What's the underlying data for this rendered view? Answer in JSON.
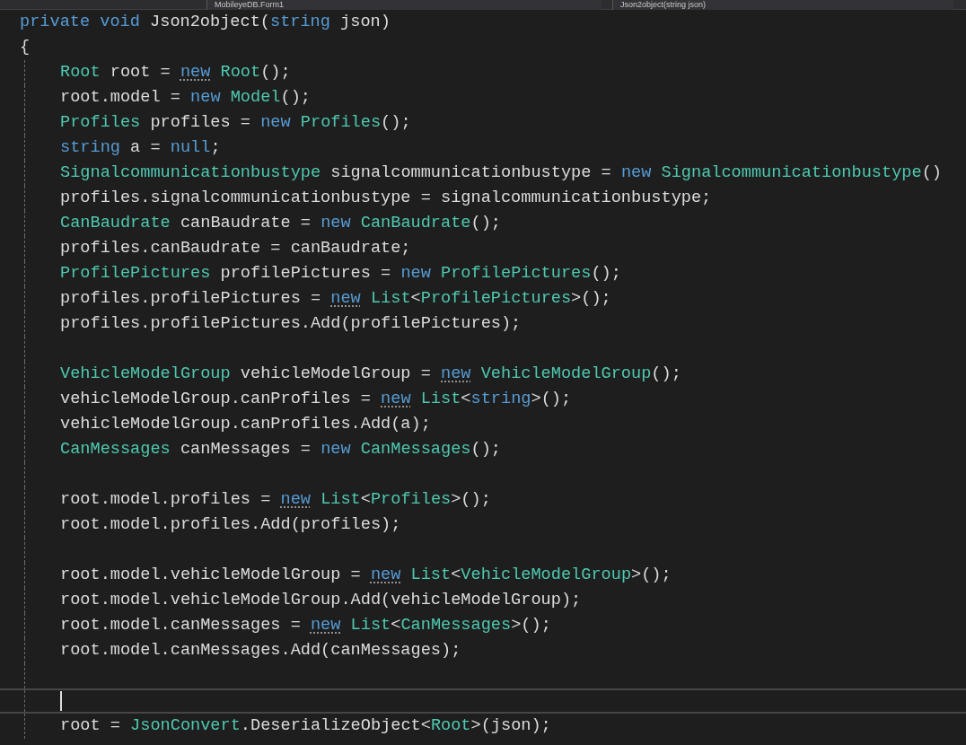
{
  "navigation_bar": {
    "class_dropdown": "MobileyeDB.Form1",
    "member_dropdown": "Json2object(string json)"
  },
  "code_lines": [
    {
      "current": false,
      "tokens": [
        {
          "kind": "keyword",
          "text": "private void "
        },
        {
          "kind": "plain",
          "text": "Json2object("
        },
        {
          "kind": "keyword",
          "text": "string"
        },
        {
          "kind": "plain",
          "text": " json)"
        }
      ]
    },
    {
      "current": false,
      "tokens": [
        {
          "kind": "plain",
          "text": "{"
        }
      ],
      "children": [
        {
          "current": false,
          "tokens": [
            {
              "kind": "type",
              "text": "Root"
            },
            {
              "kind": "plain",
              "text": " root = "
            },
            {
              "kind": "keyword",
              "text": "new",
              "hint": true
            },
            {
              "kind": "type",
              "text": " Root"
            },
            {
              "kind": "plain",
              "text": "();"
            }
          ]
        },
        {
          "current": false,
          "tokens": [
            {
              "kind": "plain",
              "text": "root.model = "
            },
            {
              "kind": "keyword",
              "text": "new"
            },
            {
              "kind": "type",
              "text": " Model"
            },
            {
              "kind": "plain",
              "text": "();"
            }
          ]
        },
        {
          "current": false,
          "tokens": [
            {
              "kind": "type",
              "text": "Profiles"
            },
            {
              "kind": "plain",
              "text": " profiles = "
            },
            {
              "kind": "keyword",
              "text": "new"
            },
            {
              "kind": "type",
              "text": " Profiles"
            },
            {
              "kind": "plain",
              "text": "();"
            }
          ]
        },
        {
          "current": false,
          "tokens": [
            {
              "kind": "keyword",
              "text": "string"
            },
            {
              "kind": "plain",
              "text": " a = "
            },
            {
              "kind": "keyword",
              "text": "null"
            },
            {
              "kind": "plain",
              "text": ";"
            }
          ]
        },
        {
          "current": false,
          "tokens": [
            {
              "kind": "type",
              "text": "Signalcommunicationbustype"
            },
            {
              "kind": "plain",
              "text": " signalcommunicationbustype = "
            },
            {
              "kind": "keyword",
              "text": "new"
            },
            {
              "kind": "type",
              "text": " Signalcommunicationbustype"
            },
            {
              "kind": "plain",
              "text": "()"
            }
          ]
        },
        {
          "current": false,
          "tokens": [
            {
              "kind": "plain",
              "text": "profiles.signalcommunicationbustype = signalcommunicationbustype;"
            }
          ]
        },
        {
          "current": false,
          "tokens": [
            {
              "kind": "type",
              "text": "CanBaudrate"
            },
            {
              "kind": "plain",
              "text": " canBaudrate = "
            },
            {
              "kind": "keyword",
              "text": "new"
            },
            {
              "kind": "type",
              "text": " CanBaudrate"
            },
            {
              "kind": "plain",
              "text": "();"
            }
          ]
        },
        {
          "current": false,
          "tokens": [
            {
              "kind": "plain",
              "text": "profiles.canBaudrate = canBaudrate;"
            }
          ]
        },
        {
          "current": false,
          "tokens": [
            {
              "kind": "type",
              "text": "ProfilePictures"
            },
            {
              "kind": "plain",
              "text": " profilePictures = "
            },
            {
              "kind": "keyword",
              "text": "new"
            },
            {
              "kind": "type",
              "text": " ProfilePictures"
            },
            {
              "kind": "plain",
              "text": "();"
            }
          ]
        },
        {
          "current": false,
          "tokens": [
            {
              "kind": "plain",
              "text": "profiles.profilePictures = "
            },
            {
              "kind": "keyword",
              "text": "new",
              "hint": true
            },
            {
              "kind": "type",
              "text": " List"
            },
            {
              "kind": "plain",
              "text": "<"
            },
            {
              "kind": "type",
              "text": "ProfilePictures"
            },
            {
              "kind": "plain",
              "text": ">();"
            }
          ]
        },
        {
          "current": false,
          "tokens": [
            {
              "kind": "plain",
              "text": "profiles.profilePictures.Add(profilePictures);"
            }
          ]
        },
        {
          "current": false
        },
        {
          "current": false,
          "tokens": [
            {
              "kind": "type",
              "text": "VehicleModelGroup"
            },
            {
              "kind": "plain",
              "text": " vehicleModelGroup = "
            },
            {
              "kind": "keyword",
              "text": "new",
              "hint": true
            },
            {
              "kind": "type",
              "text": " VehicleModelGroup"
            },
            {
              "kind": "plain",
              "text": "();"
            }
          ]
        },
        {
          "current": false,
          "tokens": [
            {
              "kind": "plain",
              "text": "vehicleModelGroup.canProfiles = "
            },
            {
              "kind": "keyword",
              "text": "new",
              "hint": true
            },
            {
              "kind": "type",
              "text": " List"
            },
            {
              "kind": "plain",
              "text": "<"
            },
            {
              "kind": "keyword",
              "text": "string"
            },
            {
              "kind": "plain",
              "text": ">();"
            }
          ]
        },
        {
          "current": false,
          "tokens": [
            {
              "kind": "plain",
              "text": "vehicleModelGroup.canProfiles.Add(a);"
            }
          ]
        },
        {
          "current": false,
          "tokens": [
            {
              "kind": "type",
              "text": "CanMessages"
            },
            {
              "kind": "plain",
              "text": " canMessages = "
            },
            {
              "kind": "keyword",
              "text": "new"
            },
            {
              "kind": "type",
              "text": " CanMessages"
            },
            {
              "kind": "plain",
              "text": "();"
            }
          ]
        },
        {
          "current": false
        },
        {
          "current": false,
          "tokens": [
            {
              "kind": "plain",
              "text": "root.model.profiles = "
            },
            {
              "kind": "keyword",
              "text": "new",
              "hint": true
            },
            {
              "kind": "type",
              "text": " List"
            },
            {
              "kind": "plain",
              "text": "<"
            },
            {
              "kind": "type",
              "text": "Profiles"
            },
            {
              "kind": "plain",
              "text": ">();"
            }
          ]
        },
        {
          "current": false,
          "tokens": [
            {
              "kind": "plain",
              "text": "root.model.profiles.Add(profiles);"
            }
          ]
        },
        {
          "current": false
        },
        {
          "current": false,
          "tokens": [
            {
              "kind": "plain",
              "text": "root.model.vehicleModelGroup = "
            },
            {
              "kind": "keyword",
              "text": "new",
              "hint": true
            },
            {
              "kind": "type",
              "text": " List"
            },
            {
              "kind": "plain",
              "text": "<"
            },
            {
              "kind": "type",
              "text": "VehicleModelGroup"
            },
            {
              "kind": "plain",
              "text": ">();"
            }
          ]
        },
        {
          "current": false,
          "tokens": [
            {
              "kind": "plain",
              "text": "root.model.vehicleModelGroup.Add(vehicleModelGroup);"
            }
          ]
        },
        {
          "current": false,
          "tokens": [
            {
              "kind": "plain",
              "text": "root.model.canMessages = "
            },
            {
              "kind": "keyword",
              "text": "new",
              "hint": true
            },
            {
              "kind": "type",
              "text": " List"
            },
            {
              "kind": "plain",
              "text": "<"
            },
            {
              "kind": "type",
              "text": "CanMessages"
            },
            {
              "kind": "plain",
              "text": ">();"
            }
          ]
        },
        {
          "current": false,
          "tokens": [
            {
              "kind": "plain",
              "text": "root.model.canMessages.Add(canMessages);"
            }
          ]
        },
        {
          "current": false
        },
        {
          "current": true
        },
        {
          "current": false,
          "tokens": [
            {
              "kind": "plain",
              "text": "root = "
            },
            {
              "kind": "type",
              "text": "JsonConvert"
            },
            {
              "kind": "plain",
              "text": ".DeserializeObject<"
            },
            {
              "kind": "type",
              "text": "Root"
            },
            {
              "kind": "plain",
              "text": ">(json);"
            }
          ]
        }
      ]
    }
  ]
}
